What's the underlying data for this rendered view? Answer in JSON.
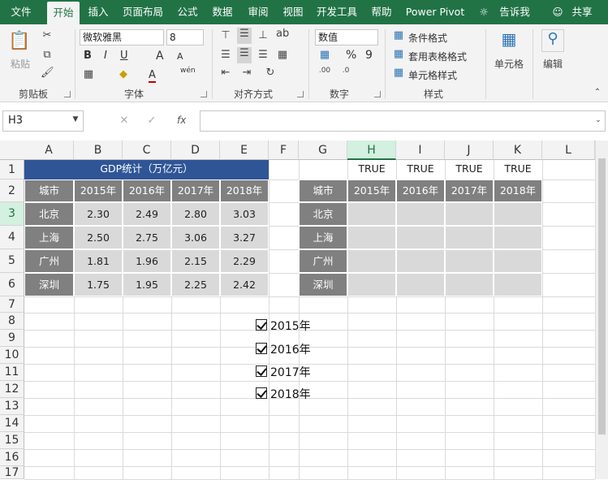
{
  "menu": {
    "tabs": [
      "文件",
      "开始",
      "插入",
      "页面布局",
      "公式",
      "数据",
      "审阅",
      "视图",
      "开发工具",
      "帮助",
      "Power Pivot"
    ],
    "active_tab": "开始",
    "tell_me": "告诉我",
    "share": "共享"
  },
  "ribbon": {
    "clipboard": {
      "paste": "粘贴",
      "label": "剪贴板"
    },
    "font": {
      "name": "微软雅黑",
      "size": "8",
      "label": "字体",
      "bold": "B",
      "italic": "I",
      "underline": "U",
      "grow": "A",
      "shrink": "A",
      "color": "A",
      "phonetic": "wén"
    },
    "alignment": {
      "label": "对齐方式"
    },
    "number": {
      "format": "数值",
      "percent": "%",
      "comma": "9",
      "label": "数字"
    },
    "styles": {
      "conditional": "条件格式",
      "table": "套用表格格式",
      "cell_styles": "单元格样式",
      "label": "样式"
    },
    "cells": {
      "label": "单元格"
    },
    "editing": {
      "label": "编辑"
    }
  },
  "formula_bar": {
    "name_box": "H3",
    "formula": "",
    "fx": "fx"
  },
  "columns": [
    "A",
    "B",
    "C",
    "D",
    "E",
    "F",
    "G",
    "H",
    "I",
    "J",
    "K",
    "L"
  ],
  "rows": [
    "1",
    "2",
    "3",
    "4",
    "5",
    "6",
    "7",
    "8",
    "9",
    "10",
    "11",
    "12",
    "13",
    "14",
    "15",
    "16",
    "17"
  ],
  "table_left": {
    "title": "GDP统计（万亿元）",
    "headers": [
      "城市",
      "2015年",
      "2016年",
      "2017年",
      "2018年"
    ],
    "data": [
      [
        "北京",
        "2.30",
        "2.49",
        "2.80",
        "3.03"
      ],
      [
        "上海",
        "2.50",
        "2.75",
        "3.06",
        "3.27"
      ],
      [
        "广州",
        "1.81",
        "1.96",
        "2.15",
        "2.29"
      ],
      [
        "深圳",
        "1.75",
        "1.95",
        "2.25",
        "2.42"
      ]
    ]
  },
  "table_right": {
    "flags": [
      "TRUE",
      "TRUE",
      "TRUE",
      "TRUE"
    ],
    "headers": [
      "城市",
      "2015年",
      "2016年",
      "2017年",
      "2018年"
    ],
    "cities": [
      "北京",
      "上海",
      "广州",
      "深圳"
    ]
  },
  "checkboxes": [
    {
      "label": "2015年",
      "checked": true
    },
    {
      "label": "2016年",
      "checked": true
    },
    {
      "label": "2017年",
      "checked": true
    },
    {
      "label": "2018年",
      "checked": true
    }
  ]
}
